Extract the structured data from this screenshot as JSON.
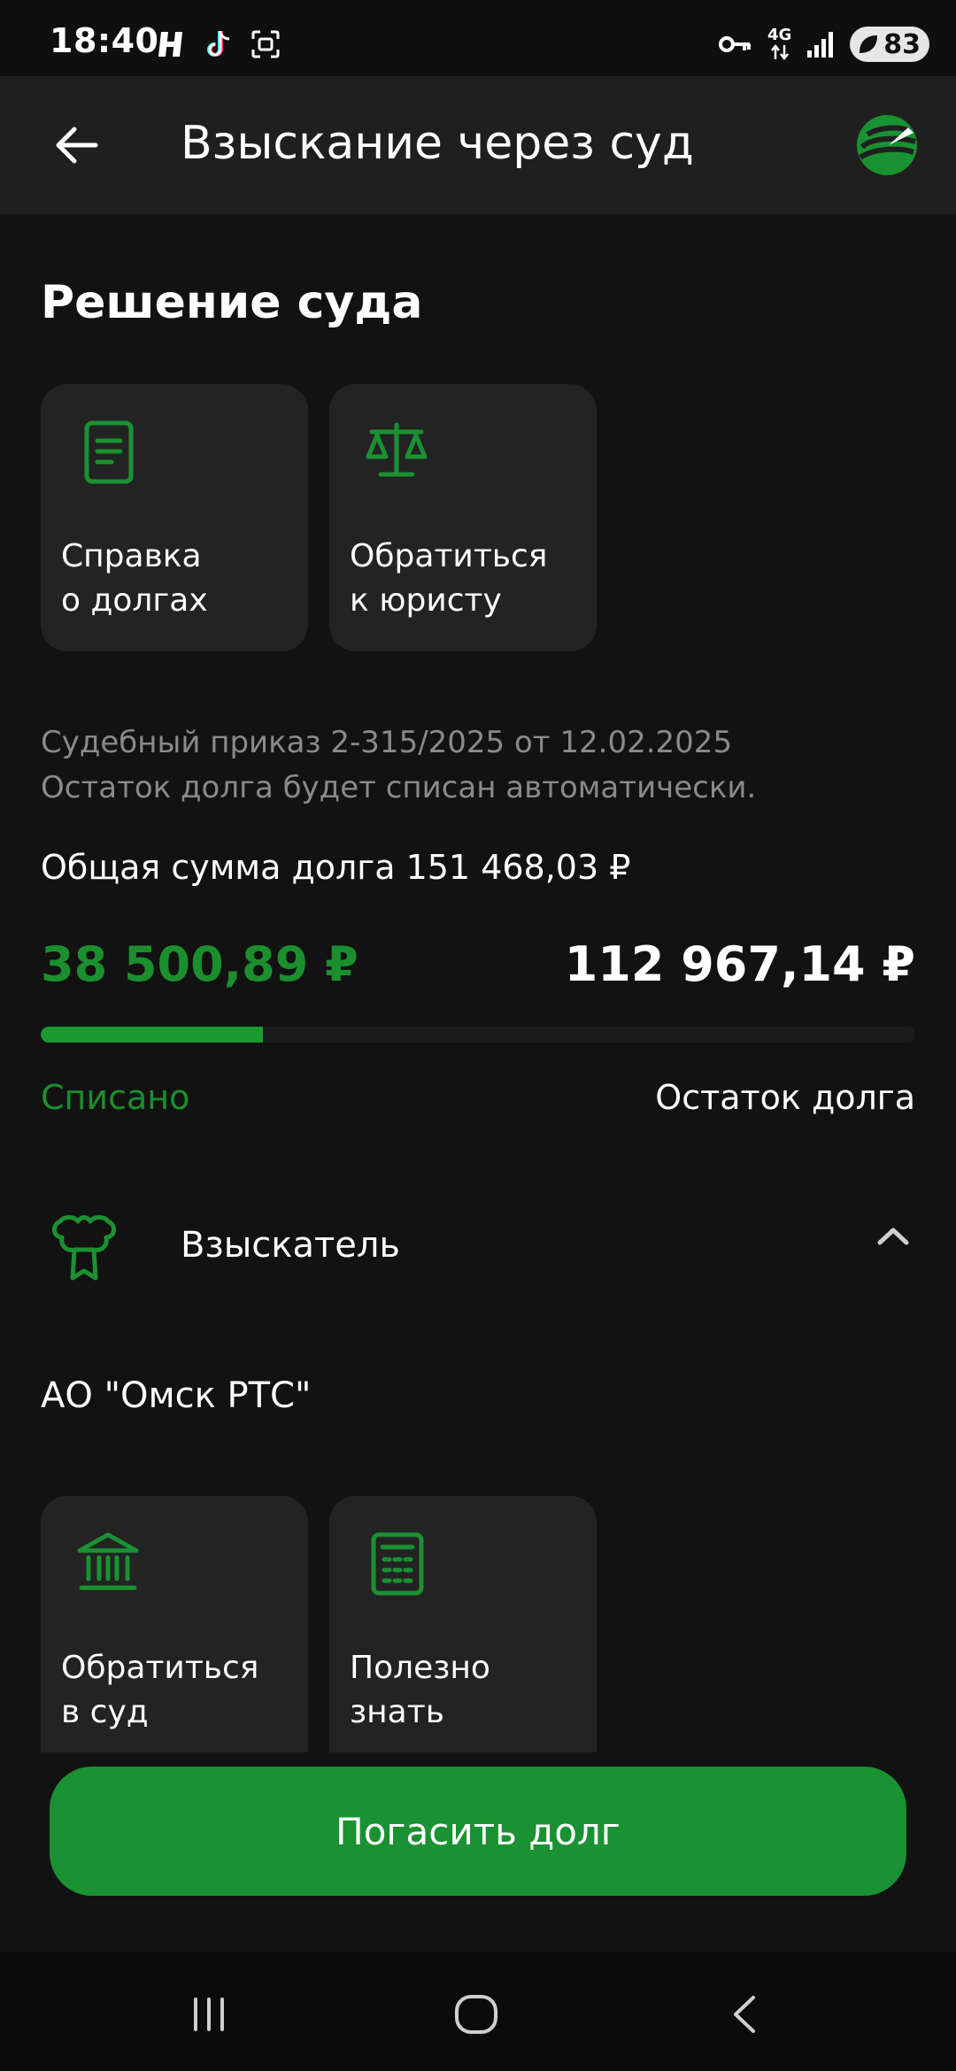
{
  "status_bar": {
    "time": "18:40",
    "network": "4G",
    "battery": "83"
  },
  "app_bar": {
    "title": "Взыскание через суд",
    "back_icon": "arrow-left-icon",
    "logo_icon": "bank-logo-icon"
  },
  "section_title": "Решение суда",
  "tiles_top": [
    {
      "label": "Справка\nо долгах",
      "icon": "document-icon"
    },
    {
      "label": "Обратиться\nк юристу",
      "icon": "scales-icon"
    }
  ],
  "court_order": {
    "line1": "Судебный приказ 2-315/2025 от 12.02.2025",
    "line2": "Остаток долга будет списан автоматически."
  },
  "debt": {
    "total_label": "Общая сумма долга 151 468,03 ₽",
    "paid_amount": "38 500,89 ₽",
    "remaining_amount": "112 967,14 ₽",
    "paid_label": "Списано",
    "remaining_label": "Остаток долга",
    "paid_fraction": 0.254
  },
  "collector": {
    "label": "Взыскатель",
    "icon": "collector-emblem-icon",
    "name": "АО \"Омск РТС\""
  },
  "tiles_bottom": [
    {
      "label": "Обратиться\nв суд",
      "icon": "court-building-icon"
    },
    {
      "label": "Полезно\nзнать",
      "icon": "calculator-icon"
    }
  ],
  "primary_button": {
    "label": "Погасить долг"
  },
  "colors": {
    "accent": "#1a9132",
    "background": "#121212",
    "tile": "#232323"
  }
}
